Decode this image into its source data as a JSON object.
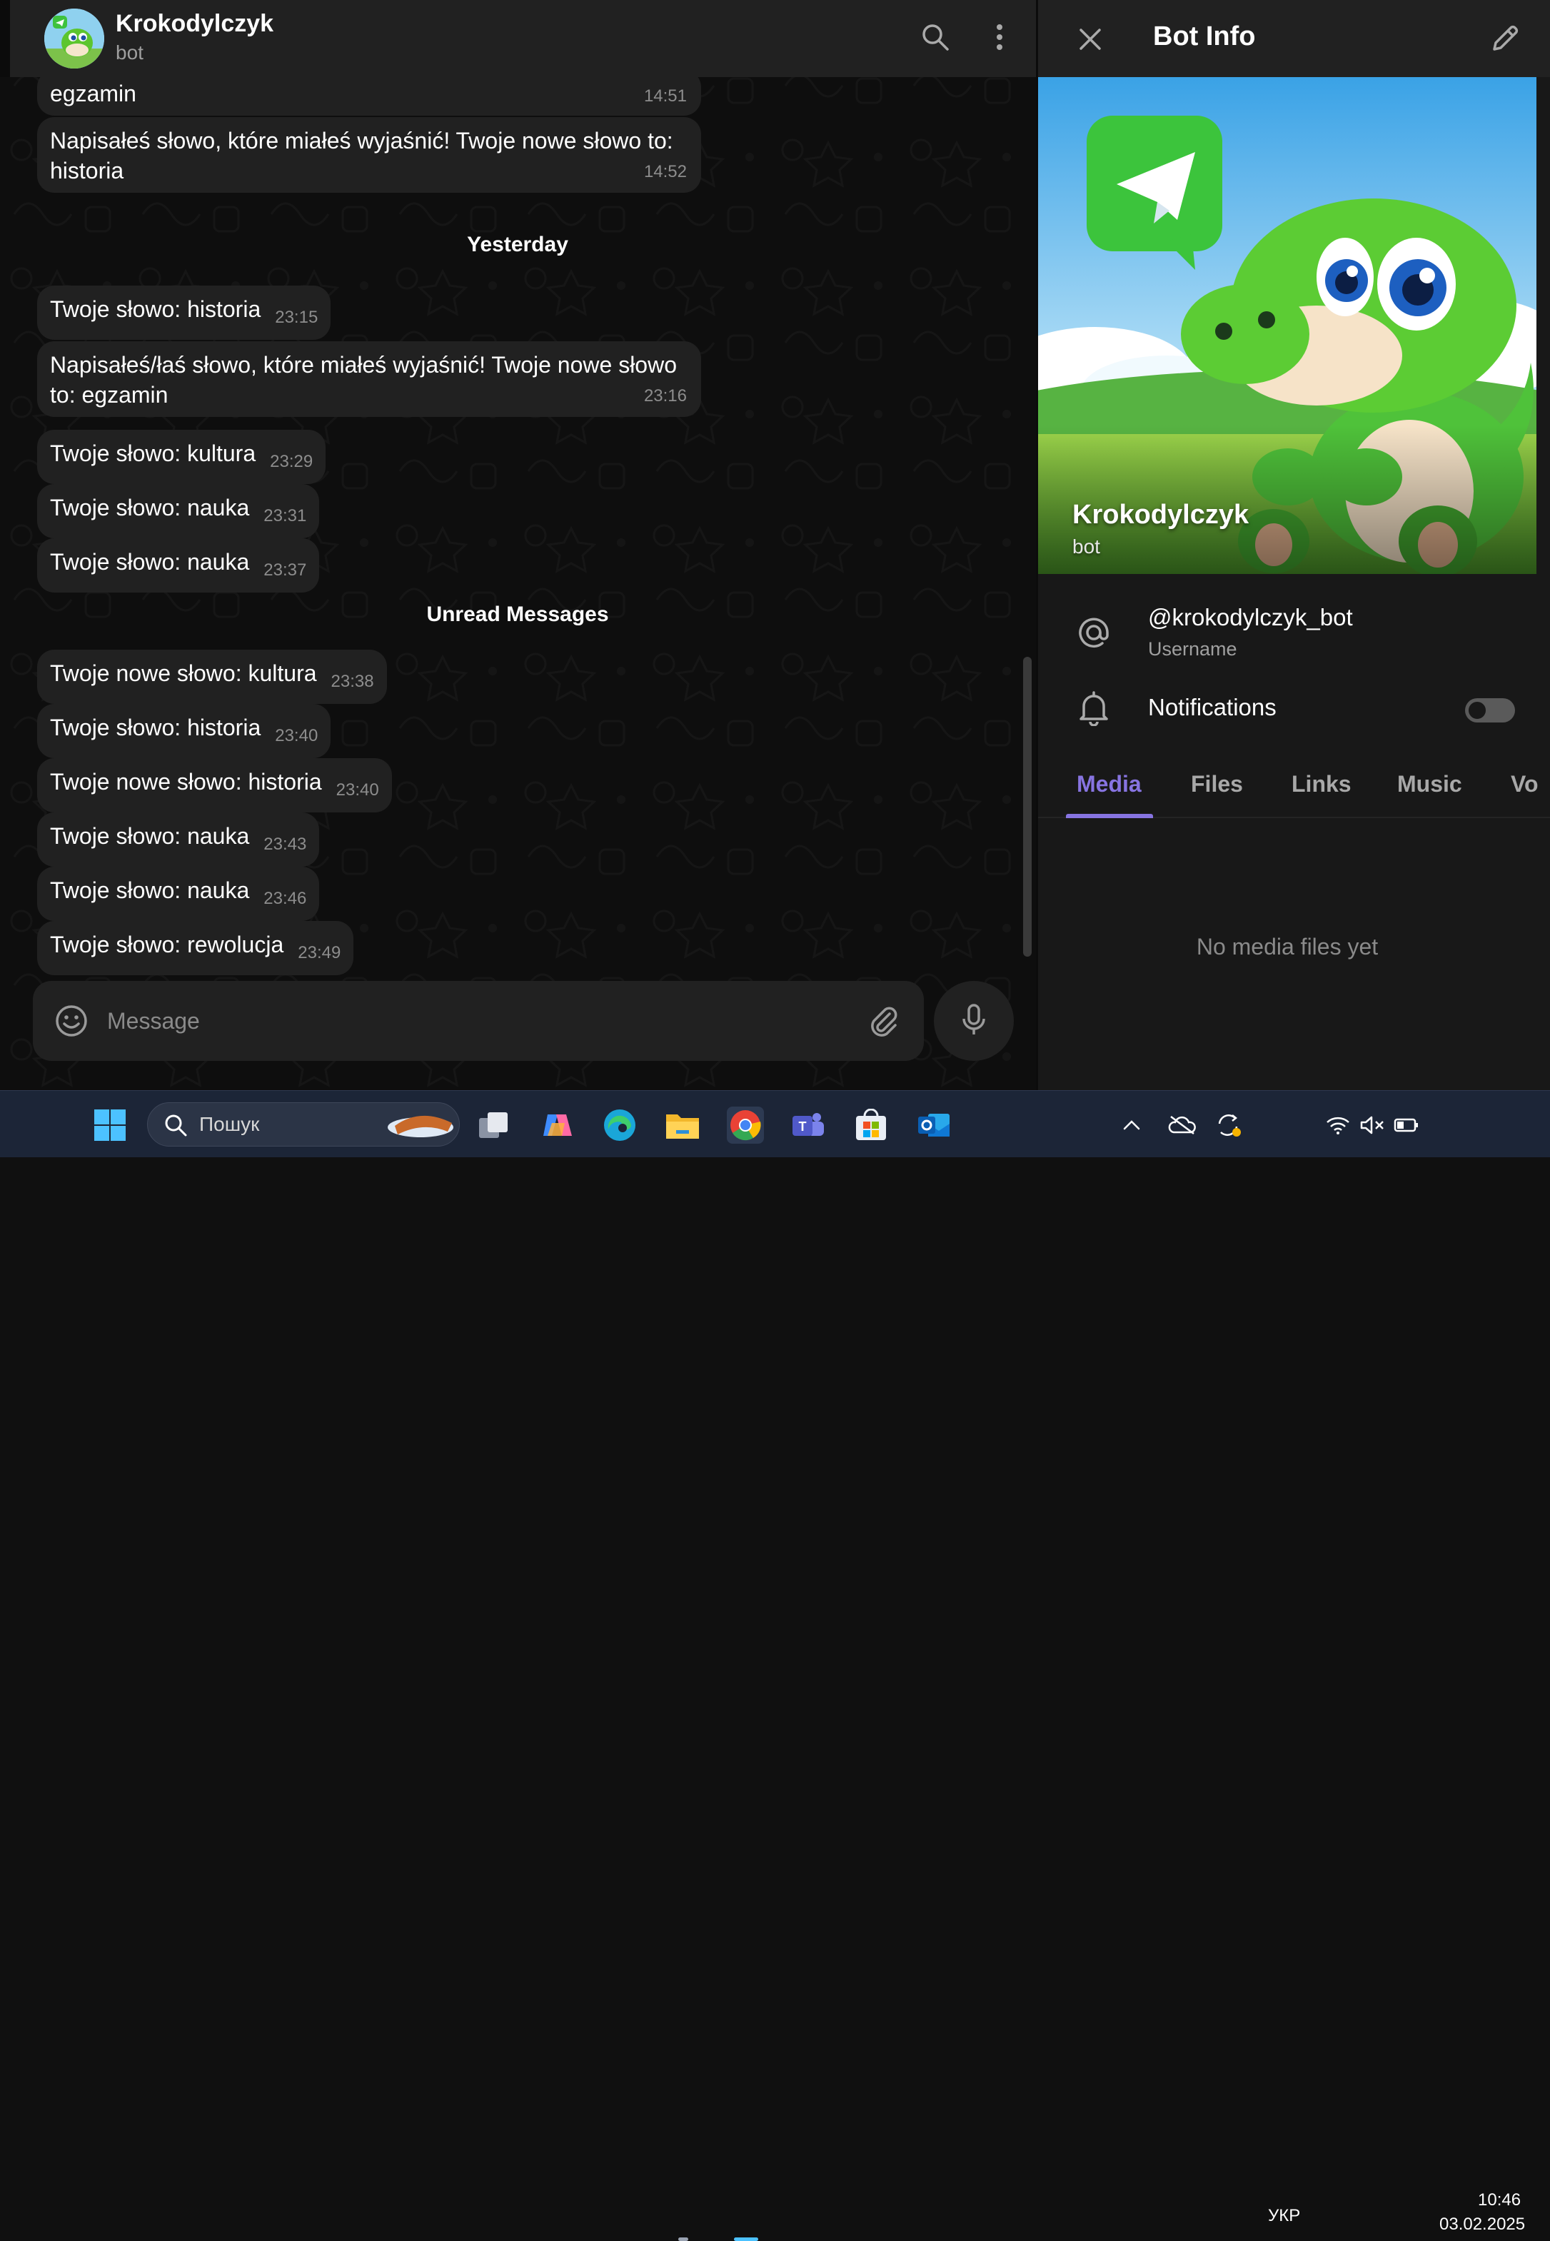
{
  "chat": {
    "title": "Krokodylczyk",
    "subtitle": "bot",
    "messages": [
      {
        "text": "egzamin",
        "time": "14:51"
      },
      {
        "text": "Napisałeś słowo, które miałeś wyjaśnić! Twoje nowe słowo to: historia",
        "line1": "Napisałeś słowo, które miałeś wyjaśnić! Twoje nowe słowo to:",
        "line2": "historia",
        "time": "14:52"
      },
      {
        "text": "Twoje słowo: historia",
        "time": "23:15"
      },
      {
        "text": "Napisałeś/łaś słowo, które miałeś wyjaśnić! Twoje nowe słowo to: egzamin",
        "line1": "Napisałeś/łaś słowo, które miałeś wyjaśnić! Twoje nowe słowo",
        "line2": "to: egzamin",
        "time": "23:16"
      },
      {
        "text": "Twoje słowo: kultura",
        "time": "23:29"
      },
      {
        "text": "Twoje słowo: nauka",
        "time": "23:31"
      },
      {
        "text": "Twoje słowo: nauka",
        "time": "23:37"
      },
      {
        "text": "Twoje nowe słowo: kultura",
        "time": "23:38"
      },
      {
        "text": "Twoje słowo: historia",
        "time": "23:40"
      },
      {
        "text": "Twoje nowe słowo: historia",
        "time": "23:40"
      },
      {
        "text": "Twoje słowo: nauka",
        "time": "23:43"
      },
      {
        "text": "Twoje słowo: nauka",
        "time": "23:46"
      },
      {
        "text": "Twoje słowo: rewolucja",
        "time": "23:49"
      }
    ],
    "date_separator": "Yesterday",
    "unread_separator": "Unread Messages",
    "composer": {
      "placeholder": "Message"
    }
  },
  "info": {
    "title": "Bot Info",
    "hero_name": "Krokodylczyk",
    "hero_sub": "bot",
    "username": "@krokodylczyk_bot",
    "username_label": "Username",
    "notifications_label": "Notifications",
    "notifications_enabled": false,
    "tabs": [
      "Media",
      "Files",
      "Links",
      "Music",
      "Vo"
    ],
    "active_tab": "Media",
    "empty_text": "No media files yet"
  },
  "taskbar": {
    "search_placeholder": "Пошук",
    "language": "УКР",
    "time": "10:46",
    "date": "03.02.2025"
  },
  "colors": {
    "accent": "#8774e1",
    "bubble": "#212121",
    "header": "#212121",
    "taskbar": "#1c2537"
  }
}
